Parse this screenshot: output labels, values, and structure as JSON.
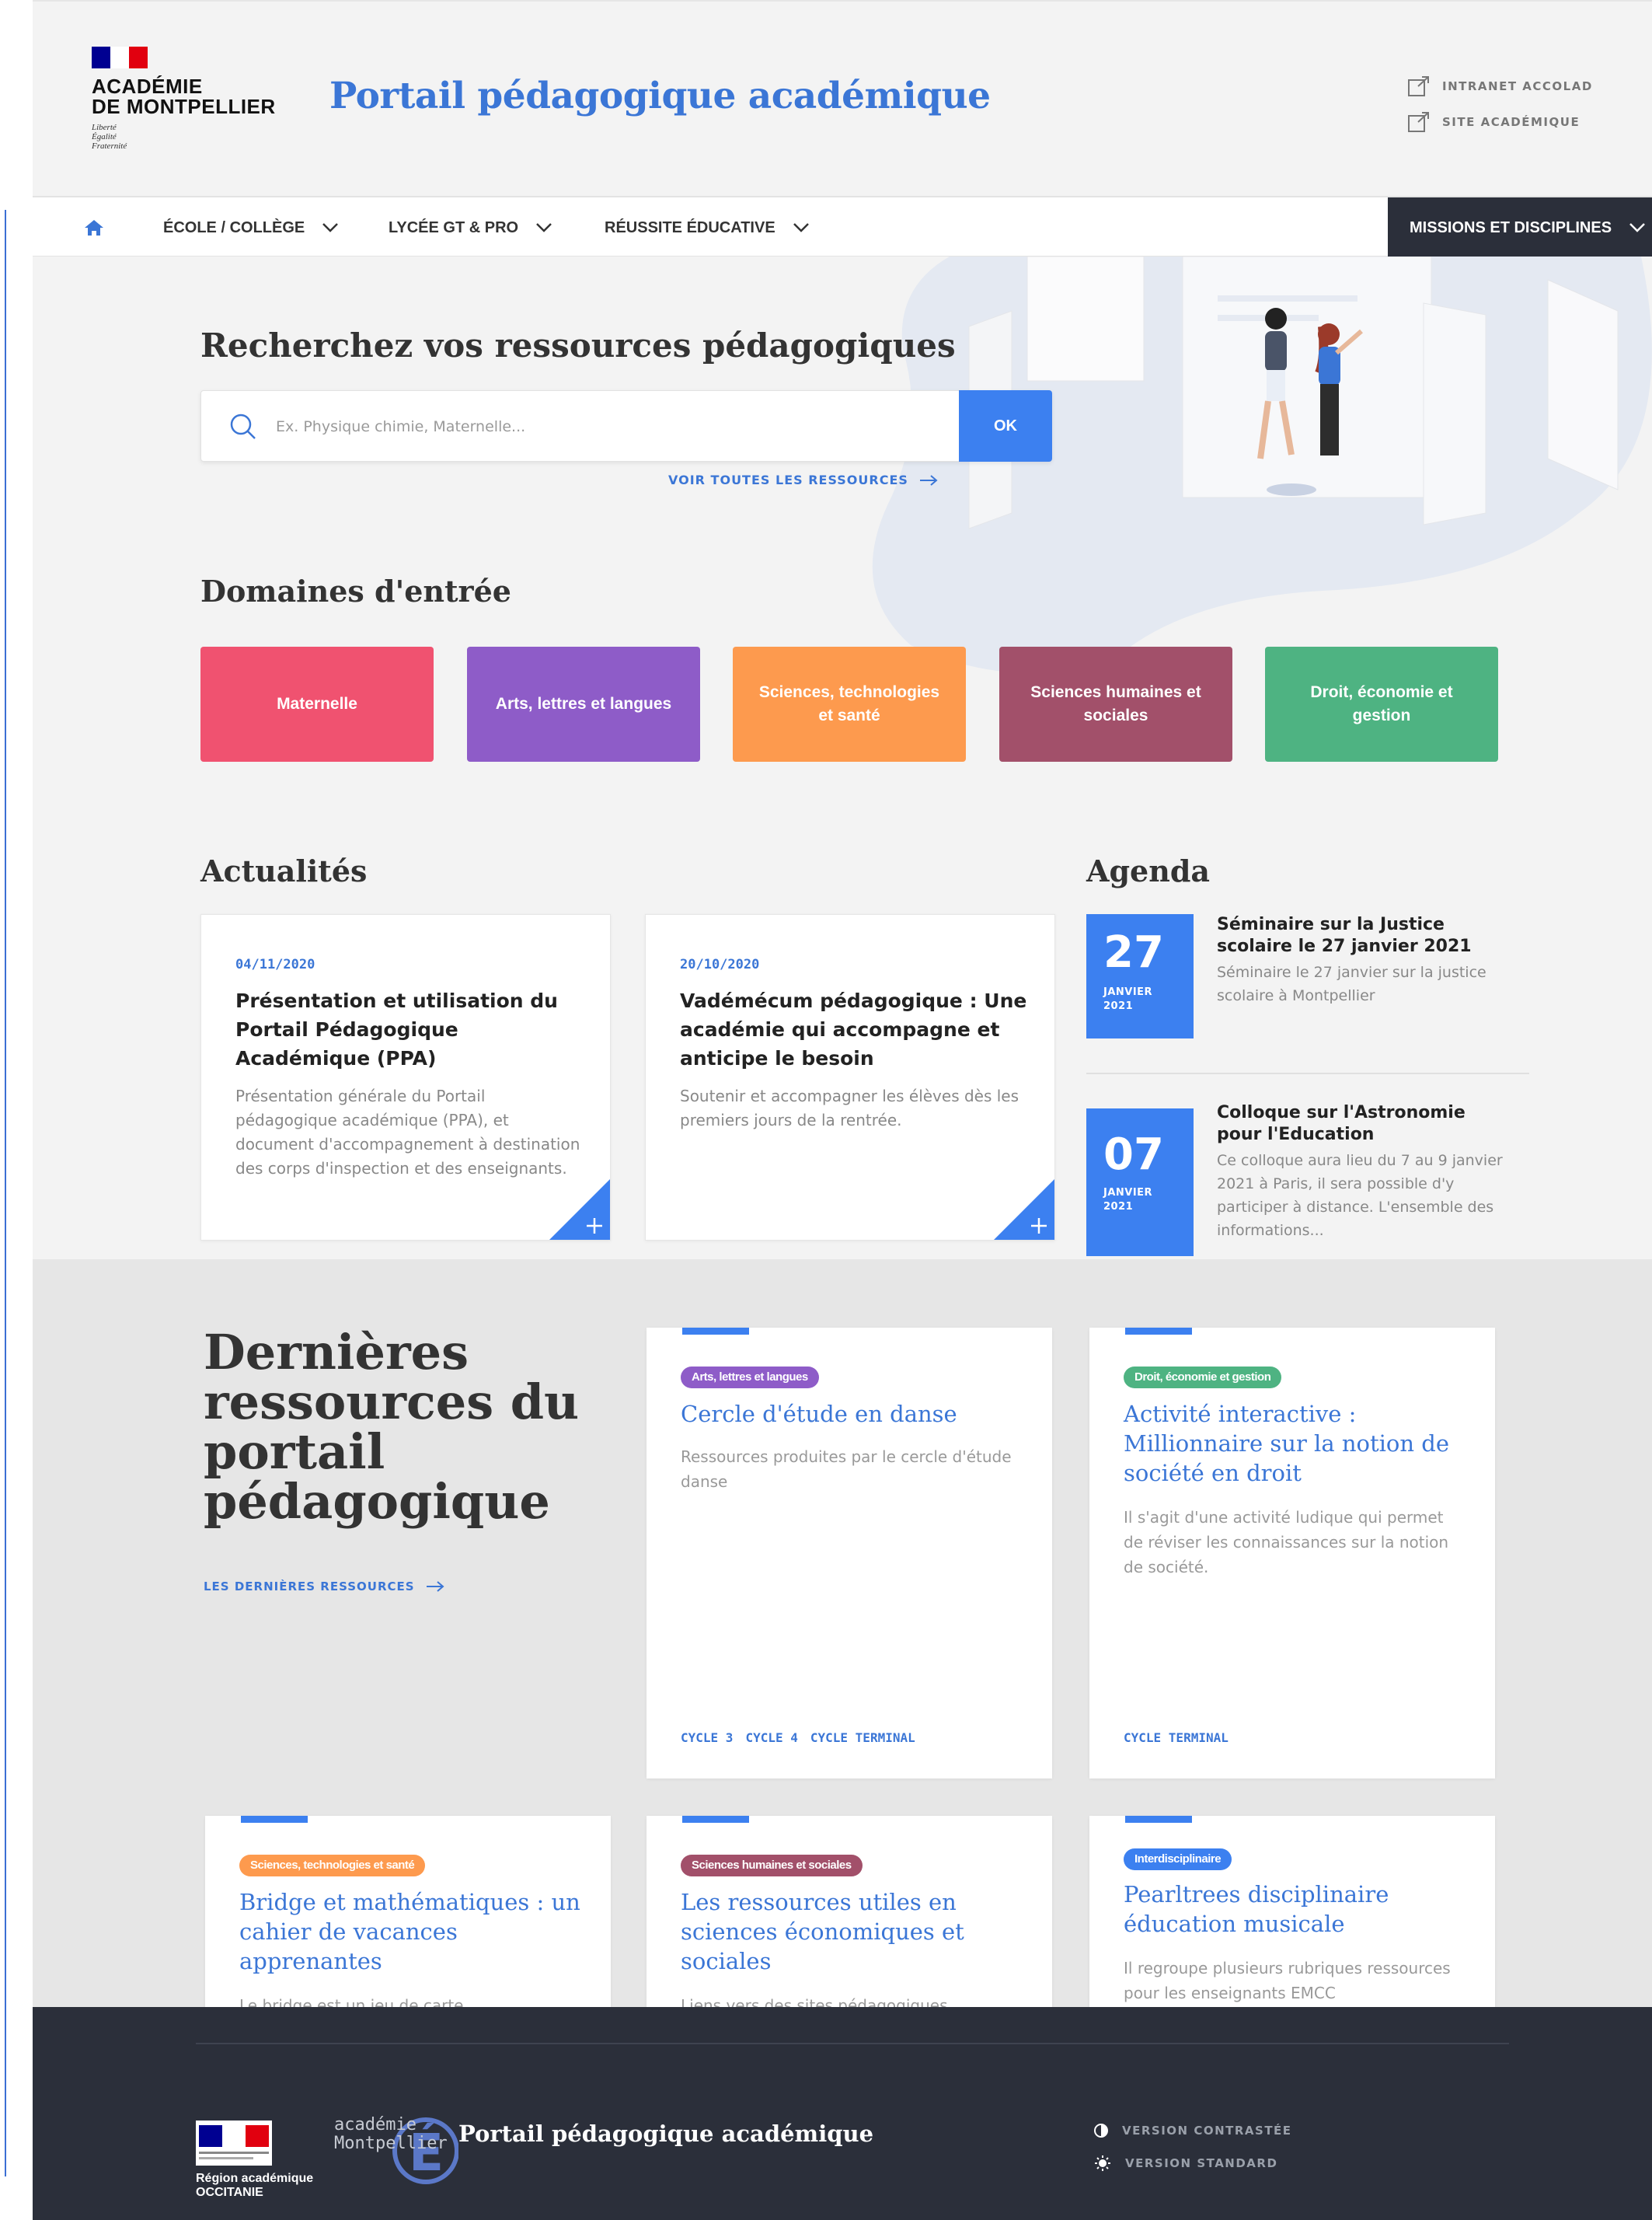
{
  "header": {
    "logo_line1": "ACADÉMIE",
    "logo_line2": "DE MONTPELLIER",
    "logo_motto": [
      "Liberté",
      "Égalité",
      "Fraternité"
    ],
    "site_title": "Portail pédagogique académique",
    "ext_links": [
      {
        "label": "INTRANET ACCOLAD"
      },
      {
        "label": "SITE ACADÉMIQUE"
      }
    ]
  },
  "nav": {
    "items": [
      {
        "label": "ÉCOLE / COLLÈGE"
      },
      {
        "label": "LYCÉE GT & PRO"
      },
      {
        "label": "RÉUSSITE ÉDUCATIVE"
      }
    ],
    "missions_label": "MISSIONS ET DISCIPLINES"
  },
  "search": {
    "title": "Recherchez vos ressources pédagogiques",
    "placeholder": "Ex. Physique chimie, Maternelle...",
    "button": "OK",
    "see_all": "VOIR TOUTES LES RESSOURCES"
  },
  "domains": {
    "title": "Domaines d'entrée",
    "items": [
      {
        "label": "Maternelle",
        "color": "#f05270"
      },
      {
        "label": "Arts, lettres et langues",
        "color": "#8e5cc8"
      },
      {
        "label": "Sciences, technologies et santé",
        "color": "#fd9a4e"
      },
      {
        "label": "Sciences humaines et sociales",
        "color": "#a2506a"
      },
      {
        "label": "Droit, économie et gestion",
        "color": "#4eb382"
      }
    ]
  },
  "news": {
    "title": "Actualités",
    "items": [
      {
        "date": "04/11/2020",
        "title": "Présentation et utilisation du Portail Pédagogique Académique (PPA)",
        "text": "Présentation générale du Portail pédagogique académique (PPA), et document d'accompagnement à destination des corps d'inspection et des enseignants."
      },
      {
        "date": "20/10/2020",
        "title": "Vadémécum pédagogique : Une académie qui accompagne et anticipe le besoin",
        "text": "Soutenir et accompagner les élèves dès les premiers jours de la rentrée."
      }
    ]
  },
  "agenda": {
    "title": "Agenda",
    "items": [
      {
        "day": "27",
        "month": "JANVIER",
        "year": "2021",
        "title": "Séminaire sur la Justice scolaire le 27 janvier 2021",
        "text": "Séminaire le 27 janvier sur la justice scolaire à Montpellier"
      },
      {
        "day": "07",
        "month": "JANVIER",
        "year": "2021",
        "title": "Colloque sur l'Astronomie pour l'Education",
        "text": "Ce colloque aura lieu du 7 au 9 janvier 2021 à Paris, il sera possible d'y participer à distance. L'ensemble des informations..."
      }
    ]
  },
  "resources": {
    "title": "Dernières ressources du portail pédagogique",
    "link": "LES DERNIÈRES RESSOURCES",
    "items": [
      {
        "badge": "Arts, lettres et langues",
        "badge_color": "#8e5cc8",
        "title": "Cercle d'étude en danse",
        "text": "Ressources produites par le cercle d'étude danse",
        "tags": [
          "CYCLE 3",
          "CYCLE 4",
          "CYCLE TERMINAL"
        ]
      },
      {
        "badge": "Droit, économie et gestion",
        "badge_color": "#4eb382",
        "title": "Activité interactive : Millionnaire sur la notion de société en droit",
        "text": "Il s'agit d'une activité ludique qui permet de réviser les connaissances sur la notion de société.",
        "tags": [
          "CYCLE TERMINAL"
        ]
      },
      {
        "badge": "Sciences, technologies et santé",
        "badge_color": "#fd9a4e",
        "title": "Bridge et mathématiques : un cahier de vacances apprenantes",
        "text": "Le bridge est un jeu de carte"
      },
      {
        "badge": "Sciences humaines et sociales",
        "badge_color": "#a2506a",
        "title": "Les ressources utiles en sciences économiques et sociales",
        "text": "Liens vers des sites pédagogiques"
      },
      {
        "badge": "Interdisciplinaire",
        "badge_color": "#3c80f0",
        "title": "Pearltrees disciplinaire éducation musicale",
        "text": "Il regroupe plusieurs rubriques ressources pour les enseignants EMCC"
      }
    ]
  },
  "footer": {
    "region_line1": "Région académique",
    "region_line2": "OCCITANIE",
    "acad_line1": "académie",
    "acad_line2": "Montpellier",
    "title": "Portail pédagogique académique",
    "options": [
      {
        "label": "VERSION CONTRASTÉE"
      },
      {
        "label": "VERSION STANDARD"
      }
    ]
  },
  "colors": {
    "accent": "#3c80f0",
    "title_blue": "#3b76d6",
    "dark": "#2b2f3a"
  }
}
